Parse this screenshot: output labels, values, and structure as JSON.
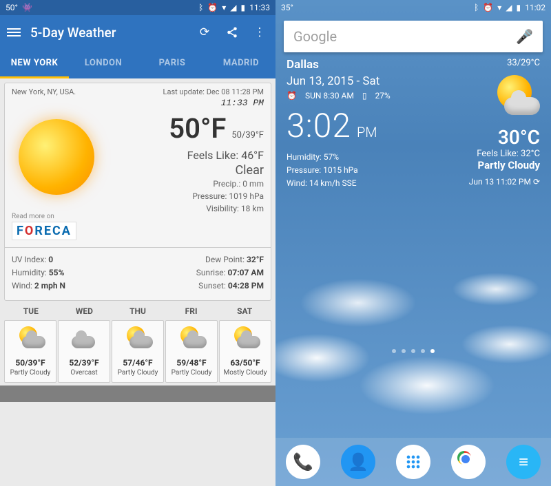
{
  "left": {
    "status": {
      "temp": "50°",
      "time": "11:33"
    },
    "appbar": {
      "title": "5-Day Weather"
    },
    "tabs": [
      "NEW YORK",
      "LONDON",
      "PARIS",
      "MADRID"
    ],
    "active_tab": 0,
    "location": "New York, NY, USA.",
    "last_update": "Last update: Dec 08  11:28 PM",
    "clock": "11:33 PM",
    "read_more": "Read more on",
    "provider": "FORECA",
    "temp": "50°F",
    "hi_lo": "50/39°F",
    "feels": "Feels Like: 46°F",
    "condition": "Clear",
    "precip": "Precip.: 0 mm",
    "pressure": "Pressure: 1019 hPa",
    "visibility": "Visibility: 18 km",
    "metrics_left": [
      {
        "lbl": "UV Index: ",
        "val": "0"
      },
      {
        "lbl": "Humidity: ",
        "val": "55%"
      },
      {
        "lbl": "Wind: ",
        "val": "2 mph N"
      }
    ],
    "metrics_right": [
      {
        "lbl": "Dew Point: ",
        "val": "32°F"
      },
      {
        "lbl": "Sunrise: ",
        "val": "07:07 AM"
      },
      {
        "lbl": "Sunset: ",
        "val": "04:28 PM"
      }
    ],
    "forecast": [
      {
        "day": "TUE",
        "temp": "50/39°F",
        "cond": "Partly Cloudy",
        "sun": true
      },
      {
        "day": "WED",
        "temp": "52/39°F",
        "cond": "Overcast",
        "sun": false
      },
      {
        "day": "THU",
        "temp": "57/46°F",
        "cond": "Partly Cloudy",
        "sun": true
      },
      {
        "day": "FRI",
        "temp": "59/48°F",
        "cond": "Partly Cloudy",
        "sun": true
      },
      {
        "day": "SAT",
        "temp": "63/50°F",
        "cond": "Mostly Cloudy",
        "sun": true
      }
    ]
  },
  "right": {
    "status": {
      "temp": "35°",
      "time": "11:02"
    },
    "search_placeholder": "Google",
    "city": "Dallas",
    "hi_lo": "33/29°C",
    "date": "Jun 13, 2015 - Sat",
    "sunrise": "SUN 8:30 AM",
    "battery": "27%",
    "clock": "3:02",
    "ampm": "PM",
    "temp": "30°C",
    "feels": "Feels Like: 32°C",
    "condition": "Partly Cloudy",
    "humidity": "Humidity: 57%",
    "pressure": "Pressure: 1015 hPa",
    "wind": "Wind: 14 km/h SSE",
    "updated": "Jun 13  11:02 PM",
    "page_dots": 5,
    "active_dot": 4
  }
}
